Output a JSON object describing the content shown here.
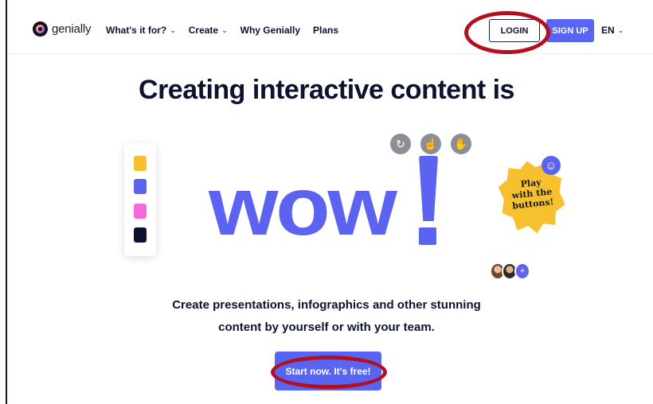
{
  "nav": {
    "logo_text": "genially",
    "links": [
      {
        "label": "What's it for?",
        "has_dropdown": true
      },
      {
        "label": "Create",
        "has_dropdown": true
      },
      {
        "label": "Why Genially",
        "has_dropdown": false
      },
      {
        "label": "Plans",
        "has_dropdown": false
      }
    ],
    "login_label": "LOGIN",
    "signup_label": "SIGN UP",
    "language": "EN"
  },
  "hero": {
    "title": "Creating interactive content is",
    "big_word": "wow",
    "subtitle_line1": "Create presentations, infographics and other stunning",
    "subtitle_line2": "content by yourself or with your team.",
    "cta_label": "Start now. It's free!",
    "badge_text": "Play\nwith the\nbuttons!"
  },
  "palette_colors": [
    "#f7c02e",
    "#5b63f0",
    "#f36ad6",
    "#0c1330"
  ],
  "gesture_icons": [
    "rotate-icon",
    "tap-icon",
    "hand-icon"
  ],
  "colors": {
    "brand": "#5865f2",
    "annotation_ring": "#b30f1e",
    "text_dark": "#0c1330"
  }
}
